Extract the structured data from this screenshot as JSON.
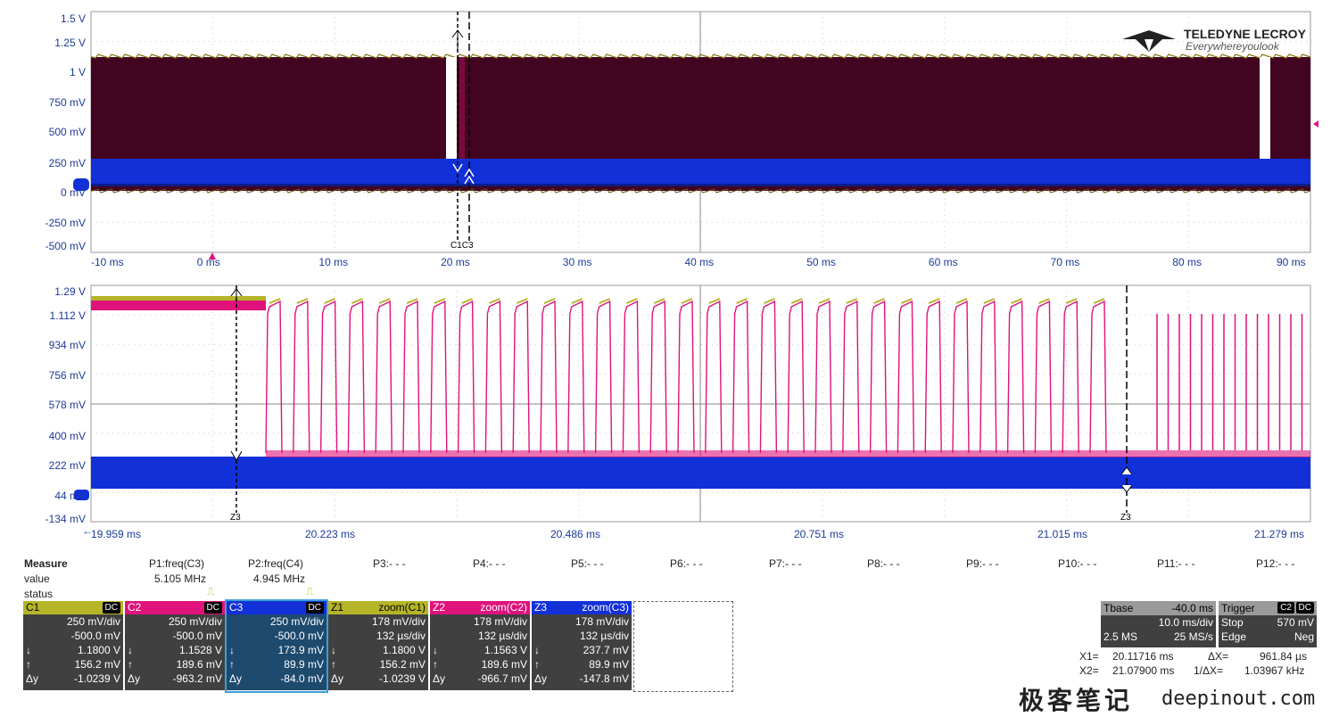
{
  "brand": {
    "name": "TELEDYNE LECROY",
    "tagline": "Everywhereyoulook"
  },
  "colors": {
    "c1": "#b5b527",
    "c2": "#e0127c",
    "c3": "#1230d8",
    "z1": "#b5b527",
    "z2": "#e0127c",
    "z3": "#1230d8",
    "envelope": "#420421",
    "axis_text": "#1c3a9b",
    "panel_bg": "#404040"
  },
  "top_grid": {
    "y_labels": [
      "1.5 V",
      "1.25 V",
      "1 V",
      "750 mV",
      "500 mV",
      "250 mV",
      "0 mV",
      "-250 mV",
      "-500 mV"
    ],
    "x_labels": [
      "-10 ms",
      "0 ms",
      "10 ms",
      "20 ms",
      "30 ms",
      "40 ms",
      "50 ms",
      "60 ms",
      "70 ms",
      "80 ms",
      "90 ms"
    ],
    "cursor_label": "C1C3",
    "cursor_ms": [
      20.11716,
      21.079
    ]
  },
  "bottom_grid": {
    "y_labels": [
      "1.29 V",
      "1.112 V",
      "934 mV",
      "756 mV",
      "578 mV",
      "400 mV",
      "222 mV",
      "44 mV",
      "-134 mV"
    ],
    "x_labels": [
      "19.959 ms",
      "20.223 ms",
      "20.486 ms",
      "20.751 ms",
      "21.015 ms",
      "21.279 ms"
    ],
    "cursor_label": "Z3"
  },
  "measure": {
    "title": "Measure",
    "row_labels": [
      "value",
      "status"
    ],
    "params": [
      {
        "name": "P1:freq(C3)",
        "value": "5.105 MHz",
        "status": "⎍"
      },
      {
        "name": "P2:freq(C4)",
        "value": "4.945 MHz",
        "status": "⎍"
      },
      {
        "name": "P3:- - -",
        "value": "",
        "status": ""
      },
      {
        "name": "P4:- - -",
        "value": "",
        "status": ""
      },
      {
        "name": "P5:- - -",
        "value": "",
        "status": ""
      },
      {
        "name": "P6:- - -",
        "value": "",
        "status": ""
      },
      {
        "name": "P7:- - -",
        "value": "",
        "status": ""
      },
      {
        "name": "P8:- - -",
        "value": "",
        "status": ""
      },
      {
        "name": "P9:- - -",
        "value": "",
        "status": ""
      },
      {
        "name": "P10:- - -",
        "value": "",
        "status": ""
      },
      {
        "name": "P11:- - -",
        "value": "",
        "status": ""
      },
      {
        "name": "P12:- - -",
        "value": "",
        "status": ""
      }
    ]
  },
  "channels": [
    {
      "name": "C1",
      "badge": "DC",
      "rows": [
        [
          "",
          "250 mV/div"
        ],
        [
          "",
          "-500.0 mV"
        ],
        [
          "↓",
          "1.1800 V"
        ],
        [
          "↑",
          "156.2 mV"
        ],
        [
          "Δy",
          "-1.0239 V"
        ]
      ]
    },
    {
      "name": "C2",
      "badge": "DC",
      "rows": [
        [
          "",
          "250 mV/div"
        ],
        [
          "",
          "-500.0 mV"
        ],
        [
          "↓",
          "1.1528 V"
        ],
        [
          "↑",
          "189.6 mV"
        ],
        [
          "Δy",
          "-963.2 mV"
        ]
      ]
    },
    {
      "name": "C3",
      "badge": "DC",
      "rows": [
        [
          "",
          "250 mV/div"
        ],
        [
          "",
          "-500.0 mV"
        ],
        [
          "↓",
          "173.9 mV"
        ],
        [
          "↑",
          "89.9 mV"
        ],
        [
          "Δy",
          "-84.0 mV"
        ]
      ]
    },
    {
      "name": "Z1",
      "badge": "zoom(C1)",
      "rows": [
        [
          "",
          "178 mV/div"
        ],
        [
          "",
          "132 µs/div"
        ],
        [
          "↓",
          "1.1800 V"
        ],
        [
          "↑",
          "156.2 mV"
        ],
        [
          "Δy",
          "-1.0239 V"
        ]
      ]
    },
    {
      "name": "Z2",
      "badge": "zoom(C2)",
      "rows": [
        [
          "",
          "178 mV/div"
        ],
        [
          "",
          "132 µs/div"
        ],
        [
          "↓",
          "1.1563 V"
        ],
        [
          "↑",
          "189.6 mV"
        ],
        [
          "Δy",
          "-966.7 mV"
        ]
      ]
    },
    {
      "name": "Z3",
      "badge": "zoom(C3)",
      "rows": [
        [
          "",
          "178 mV/div"
        ],
        [
          "",
          "132 µs/div"
        ],
        [
          "↓",
          "237.7 mV"
        ],
        [
          "↑",
          "89.9 mV"
        ],
        [
          "Δy",
          "-147.8 mV"
        ]
      ]
    }
  ],
  "timebase": {
    "label": "Tbase",
    "offset": "-40.0 ms",
    "div": "10.0 ms/div",
    "samples": "2.5 MS",
    "rate": "25 MS/s"
  },
  "trigger": {
    "label": "Trigger",
    "badge1": "C2",
    "badge2": "DC",
    "mode": "Stop",
    "level": "570 mV",
    "type": "Edge",
    "slope": "Neg"
  },
  "cursors": {
    "x1_label": "X1=",
    "x1": "20.11716 ms",
    "dx_label": "ΔX=",
    "dx": "961.84 µs",
    "x2_label": "X2=",
    "x2": "21.07900 ms",
    "inv_label": "1/ΔX=",
    "inv": "1.03967 kHz"
  },
  "watermark": {
    "cn": "极客笔记",
    "url": "deepinout.com"
  }
}
